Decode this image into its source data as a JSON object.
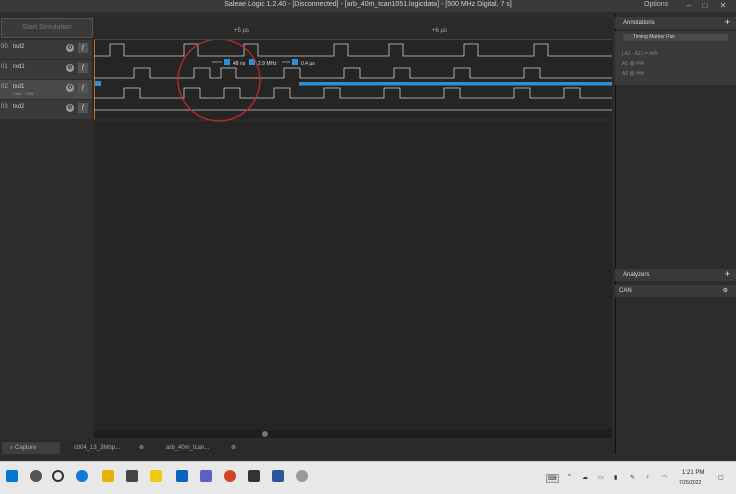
{
  "window": {
    "title": "Saleae Logic 1.2.40 - [Disconnected] - [arb_40m_tcan1051.logicdata] - [500 MHz Digital, 7 s]",
    "options_label": "Options"
  },
  "toolbar": {
    "start_label": "Start Simulation"
  },
  "ruler": {
    "ticks": [
      {
        "label": "+5 µs"
      },
      {
        "label": "+6 µs"
      }
    ]
  },
  "channels": [
    {
      "num": "00",
      "name": "txd2",
      "sub": ""
    },
    {
      "num": "01",
      "name": "rxd1",
      "sub": ""
    },
    {
      "num": "02",
      "name": "txd1",
      "sub": "CAN · CAN"
    },
    {
      "num": "03",
      "name": "txd2",
      "sub": ""
    }
  ],
  "measurement": {
    "width": "48 ns",
    "freq": "2.9 MHz",
    "period": "0.4 µs"
  },
  "annotations": {
    "header": "Annotations",
    "marker_name": "Timing Marker Pair",
    "lines": [
      "| A1 - A2 | = ###",
      "A1  @  ###",
      "A2  @  ###"
    ]
  },
  "analyzers": {
    "header": "Analyzers",
    "items": [
      {
        "label": "CAN"
      }
    ]
  },
  "tabs": [
    {
      "label": "Capture"
    },
    {
      "label": "ctl04_13_3Mbp..."
    },
    {
      "label": "arb_40m_tcan..."
    }
  ],
  "taskbar": {
    "time": "1:21 PM",
    "date": "7/25/2022"
  },
  "colors": {
    "accent": "#2f8fd6",
    "background": "#2c2c2c",
    "plot": "#252525",
    "waveform": "#cfcfcf",
    "circle": "#c0282d"
  }
}
